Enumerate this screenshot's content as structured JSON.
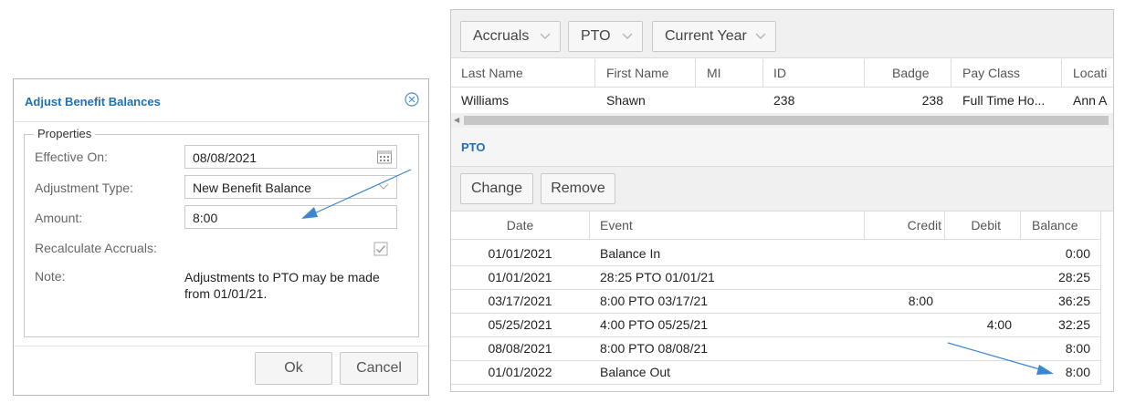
{
  "dialog": {
    "title": "Adjust Benefit Balances",
    "legend": "Properties",
    "labels": {
      "effective_on": "Effective On:",
      "adjustment_type": "Adjustment Type:",
      "amount": "Amount:",
      "recalculate": "Recalculate Accruals:",
      "note": "Note:"
    },
    "values": {
      "effective_on": "08/08/2021",
      "adjustment_type": "New Benefit Balance",
      "amount": "8:00",
      "recalculate": true,
      "note": "Adjustments to PTO may be made from 01/01/21."
    },
    "buttons": {
      "ok": "Ok",
      "cancel": "Cancel"
    }
  },
  "panel": {
    "filters": [
      {
        "label": "Accruals"
      },
      {
        "label": "PTO"
      },
      {
        "label": "Current Year"
      }
    ],
    "employee_columns": [
      "Last Name",
      "First Name",
      "MI",
      "ID",
      "Badge",
      "Pay Class",
      "Locati"
    ],
    "employee_row": {
      "last_name": "Williams",
      "first_name": "Shawn",
      "mi": "",
      "id": "238",
      "badge": "238",
      "pay_class": "Full Time Ho...",
      "location": "Ann A"
    },
    "section_title": "PTO",
    "toolbar": {
      "change": "Change",
      "remove": "Remove"
    },
    "ledger_columns": [
      "Date",
      "Event",
      "Credit",
      "Debit",
      "Balance"
    ],
    "ledger_rows": [
      {
        "date": "01/01/2021",
        "event": "Balance In",
        "credit": "",
        "debit": "",
        "balance": "0:00"
      },
      {
        "date": "01/01/2021",
        "event": "28:25 PTO 01/01/21",
        "credit": "",
        "debit": "",
        "balance": "28:25"
      },
      {
        "date": "03/17/2021",
        "event": "8:00 PTO 03/17/21",
        "credit": "8:00",
        "debit": "",
        "balance": "36:25"
      },
      {
        "date": "05/25/2021",
        "event": "4:00 PTO 05/25/21",
        "credit": "",
        "debit": "4:00",
        "balance": "32:25"
      },
      {
        "date": "08/08/2021",
        "event": "8:00 PTO 08/08/21",
        "credit": "",
        "debit": "",
        "balance": "8:00"
      },
      {
        "date": "01/01/2022",
        "event": "Balance Out",
        "credit": "",
        "debit": "",
        "balance": "8:00"
      }
    ]
  },
  "colors": {
    "accent": "#1e6fb8",
    "arrow": "#3a86d0"
  }
}
